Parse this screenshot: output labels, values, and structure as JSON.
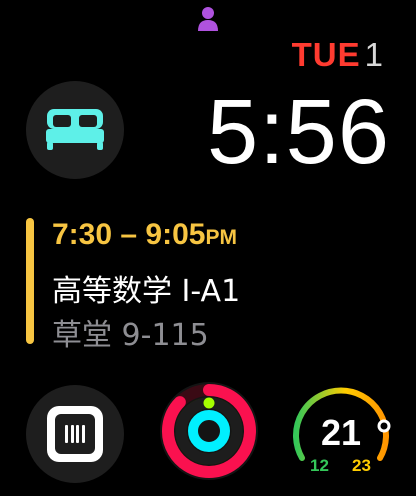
{
  "status": {
    "person_icon": "person-icon",
    "person_color": "#af52de"
  },
  "date": {
    "weekday": "TUE",
    "day": "1"
  },
  "time": "5:56",
  "sleep_complication": {
    "icon": "bed-icon",
    "color": "#5ef0e8"
  },
  "event": {
    "time_start": "7:30",
    "dash": "–",
    "time_end": "9:05",
    "ampm": "PM",
    "title": "高等数学 I-A1",
    "location": "草堂 9-115",
    "accent_color": "#f7c542"
  },
  "calendar_complication": {
    "icon": "calendar-icon"
  },
  "activity": {
    "icon": "activity-rings",
    "colors": [
      "#fa114f",
      "#a6ff00",
      "#00f0ff"
    ]
  },
  "gauge": {
    "value": "21",
    "min_label": "12",
    "max_label": "23",
    "level": 0.82
  }
}
